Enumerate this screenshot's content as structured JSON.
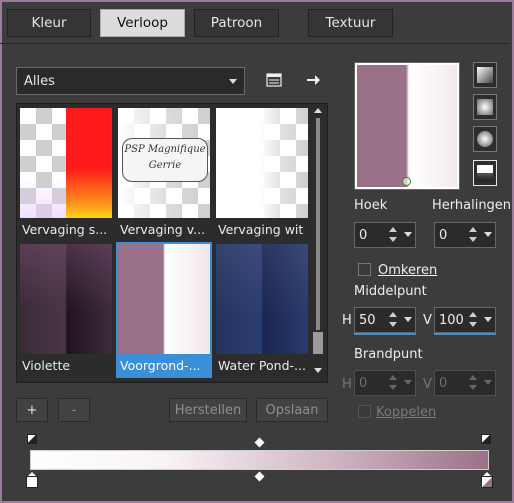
{
  "tabs": [
    {
      "label": "Kleur"
    },
    {
      "label": "Verloop"
    },
    {
      "label": "Patroon"
    },
    {
      "label": "Textuur"
    }
  ],
  "active_tab": "Verloop",
  "category_dropdown": {
    "value": "Alles"
  },
  "gallery": {
    "items": [
      {
        "caption": "Vervaging s..."
      },
      {
        "caption": "Vervaging v...",
        "watermark_line1": "PSP Magnifique",
        "watermark_line2": "Gerrie"
      },
      {
        "caption": "Vervaging wit"
      },
      {
        "caption": "Violette"
      },
      {
        "caption": "Voorgrond-..."
      },
      {
        "caption": "Water Pond-..."
      }
    ],
    "selected_index": 4
  },
  "buttons": {
    "add": "+",
    "remove": "-",
    "reset": "Herstellen",
    "save": "Opslaan"
  },
  "properties": {
    "angle_label": "Hoek",
    "angle_value": "0",
    "repeats_label": "Herhalingen",
    "repeats_value": "0",
    "invert_label": "Omkeren",
    "center_label": "Middelpunt",
    "center_h_label": "H",
    "center_h_value": "50",
    "center_v_label": "V",
    "center_v_value": "100",
    "focal_label": "Brandpunt",
    "focal_h_label": "H",
    "focal_h_value": "0",
    "focal_v_label": "V",
    "focal_v_value": "0",
    "link_label": "Koppelen"
  },
  "colors": {
    "accent": "#3b8fd8",
    "gradient_start": "#ffffff",
    "gradient_end": "#9a7188",
    "frame": "#9b7d9b"
  }
}
